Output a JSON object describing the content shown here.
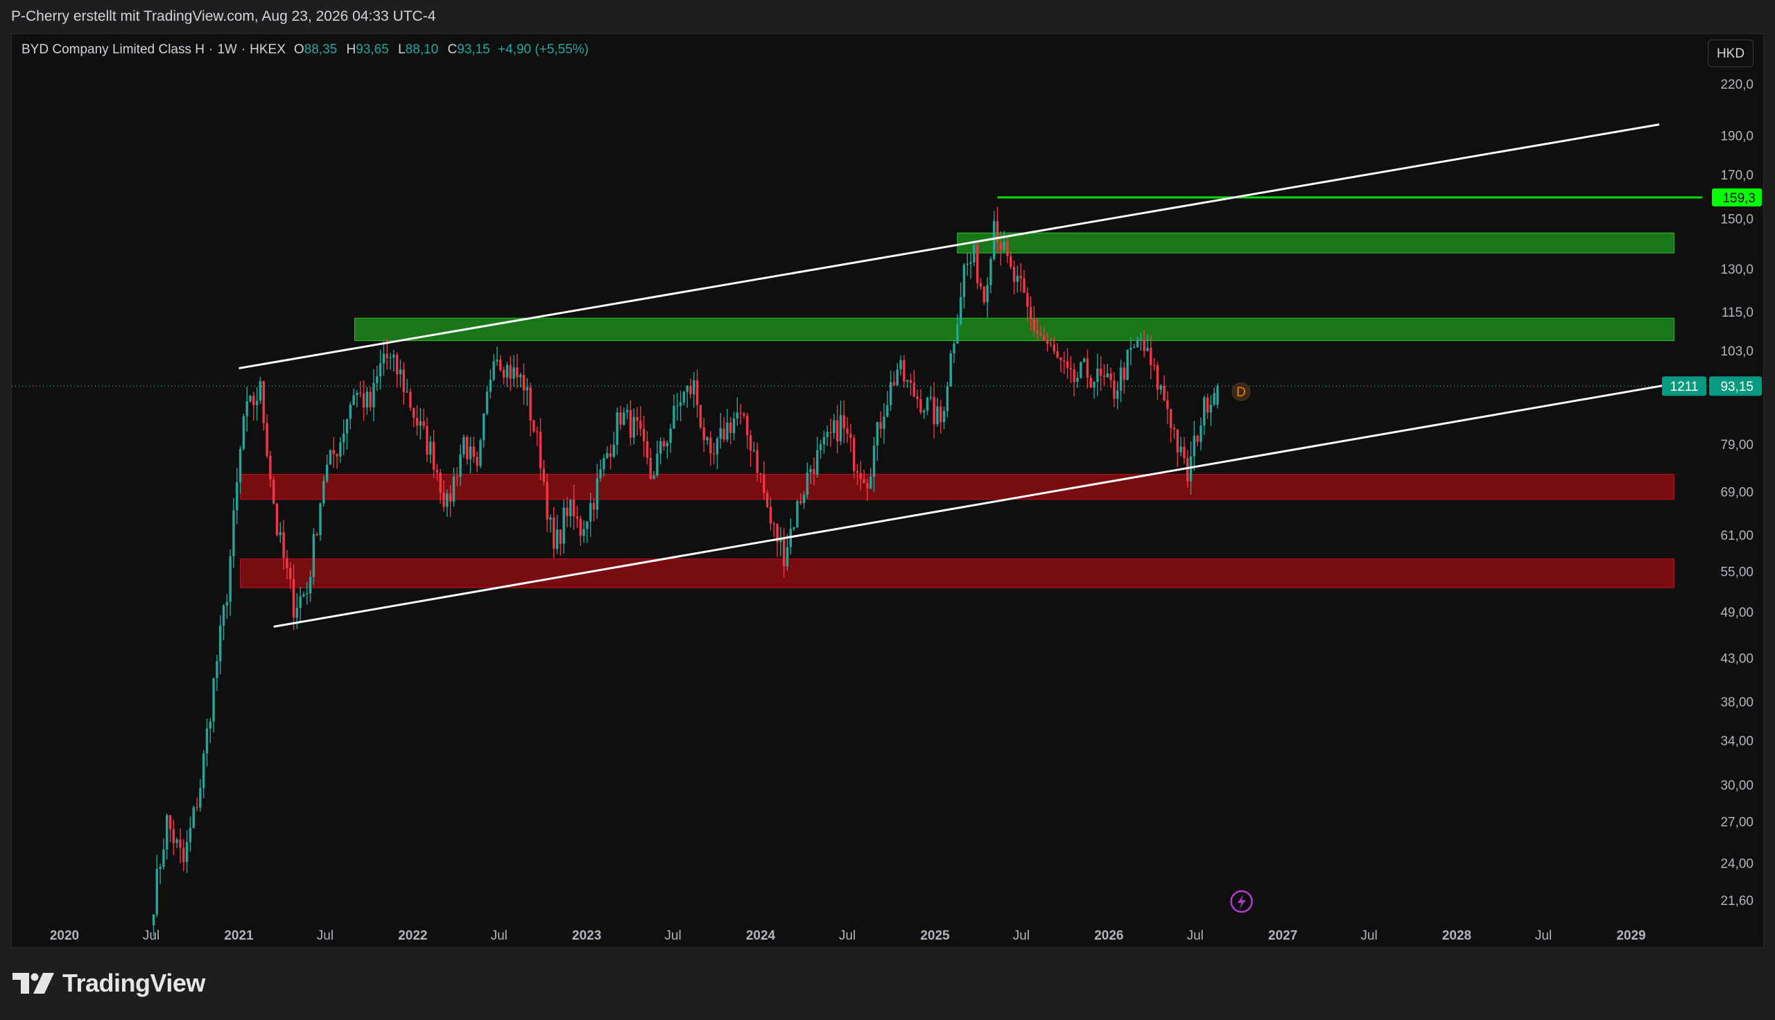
{
  "header": {
    "attribution": "P-Cherry erstellt mit TradingView.com, Aug 23, 2026 04:33 UTC-4"
  },
  "legend": {
    "symbol": "BYD Company Limited Class H",
    "interval": "1W",
    "exchange": "HKEX",
    "open_label": "O",
    "open": "88,35",
    "high_label": "H",
    "high": "93,65",
    "low_label": "L",
    "low": "88,10",
    "close_label": "C",
    "close": "93,15",
    "change": "+4,90 (+5,55%)"
  },
  "currency_button": "HKD",
  "footer": {
    "logo_text": "TradingView"
  },
  "colors": {
    "up": "#26a69a",
    "down": "#f23645",
    "background": "#0f0f0f",
    "green_zone": "#1b8a1b",
    "red_zone": "#8b0d12",
    "trendline": "#ffffff",
    "level_line": "#00e000",
    "price_label_bg": "#089981",
    "level_label_bg": "#00ff00"
  },
  "chart_data": {
    "type": "candlestick",
    "scale": "log",
    "currency": "HKD",
    "y_ticks": [
      "220,0",
      "190,0",
      "170,0",
      "150,0",
      "130,0",
      "115,0",
      "103,0",
      "79,00",
      "69,00",
      "61,00",
      "55,00",
      "49,00",
      "43,00",
      "38,00",
      "34,00",
      "30,00",
      "27,00",
      "24,00",
      "21,60"
    ],
    "x_ticks": [
      {
        "label": "2020",
        "date": "2020-01-01",
        "bold": true
      },
      {
        "label": "Jul",
        "date": "2020-07-01",
        "bold": false
      },
      {
        "label": "2021",
        "date": "2021-01-01",
        "bold": true
      },
      {
        "label": "Jul",
        "date": "2021-07-01",
        "bold": false
      },
      {
        "label": "2022",
        "date": "2022-01-01",
        "bold": true
      },
      {
        "label": "Jul",
        "date": "2022-07-01",
        "bold": false
      },
      {
        "label": "2023",
        "date": "2023-01-01",
        "bold": true
      },
      {
        "label": "Jul",
        "date": "2023-07-01",
        "bold": false
      },
      {
        "label": "2024",
        "date": "2024-01-01",
        "bold": true
      },
      {
        "label": "Jul",
        "date": "2024-07-01",
        "bold": false
      },
      {
        "label": "2025",
        "date": "2025-01-01",
        "bold": true
      },
      {
        "label": "Jul",
        "date": "2025-07-01",
        "bold": false
      },
      {
        "label": "2026",
        "date": "2026-01-01",
        "bold": true
      },
      {
        "label": "Jul",
        "date": "2026-07-01",
        "bold": false
      },
      {
        "label": "2027",
        "date": "2027-01-01",
        "bold": true
      },
      {
        "label": "Jul",
        "date": "2027-07-01",
        "bold": false
      },
      {
        "label": "2028",
        "date": "2028-01-01",
        "bold": true
      },
      {
        "label": "Jul",
        "date": "2028-07-01",
        "bold": false
      },
      {
        "label": "2029",
        "date": "2029-01-01",
        "bold": true
      }
    ],
    "price_key_points": [
      [
        "2020-07-06",
        21.6
      ],
      [
        "2020-08-03",
        27
      ],
      [
        "2020-09-07",
        24
      ],
      [
        "2020-10-12",
        30
      ],
      [
        "2020-11-09",
        40
      ],
      [
        "2020-12-07",
        52
      ],
      [
        "2021-01-11",
        85
      ],
      [
        "2021-02-15",
        92
      ],
      [
        "2021-03-22",
        62
      ],
      [
        "2021-04-26",
        50
      ],
      [
        "2021-05-24",
        52
      ],
      [
        "2021-06-28",
        72
      ],
      [
        "2021-08-02",
        80
      ],
      [
        "2021-08-30",
        92
      ],
      [
        "2021-10-04",
        88
      ],
      [
        "2021-11-01",
        102
      ],
      [
        "2021-12-06",
        96
      ],
      [
        "2022-01-10",
        84
      ],
      [
        "2022-02-14",
        76
      ],
      [
        "2022-03-14",
        66
      ],
      [
        "2022-04-18",
        80
      ],
      [
        "2022-05-16",
        72
      ],
      [
        "2022-06-20",
        104
      ],
      [
        "2022-07-18",
        98
      ],
      [
        "2022-08-22",
        94
      ],
      [
        "2022-09-26",
        76
      ],
      [
        "2022-10-24",
        58
      ],
      [
        "2022-11-21",
        66
      ],
      [
        "2022-12-19",
        62
      ],
      [
        "2023-01-16",
        68
      ],
      [
        "2023-02-13",
        77
      ],
      [
        "2023-03-13",
        86
      ],
      [
        "2023-04-17",
        82
      ],
      [
        "2023-05-15",
        72
      ],
      [
        "2023-06-19",
        81
      ],
      [
        "2023-07-17",
        90
      ],
      [
        "2023-08-14",
        93
      ],
      [
        "2023-09-18",
        74
      ],
      [
        "2023-10-16",
        82
      ],
      [
        "2023-11-13",
        86
      ],
      [
        "2023-12-18",
        78
      ],
      [
        "2024-01-22",
        63
      ],
      [
        "2024-02-19",
        58
      ],
      [
        "2024-03-18",
        66
      ],
      [
        "2024-04-15",
        74
      ],
      [
        "2024-05-13",
        78
      ],
      [
        "2024-06-17",
        84
      ],
      [
        "2024-07-15",
        76
      ],
      [
        "2024-08-12",
        72
      ],
      [
        "2024-09-16",
        88
      ],
      [
        "2024-10-14",
        98
      ],
      [
        "2024-11-11",
        92
      ],
      [
        "2024-12-16",
        88
      ],
      [
        "2025-01-13",
        84
      ],
      [
        "2025-02-10",
        108
      ],
      [
        "2025-03-03",
        130
      ],
      [
        "2025-03-24",
        134
      ],
      [
        "2025-04-14",
        120
      ],
      [
        "2025-05-05",
        150
      ],
      [
        "2025-05-19",
        140
      ],
      [
        "2025-06-09",
        128
      ],
      [
        "2025-06-30",
        122
      ],
      [
        "2025-07-21",
        112
      ],
      [
        "2025-08-18",
        106
      ],
      [
        "2025-09-15",
        100
      ],
      [
        "2025-10-13",
        94
      ],
      [
        "2025-11-10",
        97
      ],
      [
        "2025-12-08",
        95
      ],
      [
        "2026-01-12",
        92
      ],
      [
        "2026-02-09",
        100
      ],
      [
        "2026-03-09",
        106
      ],
      [
        "2026-04-06",
        96
      ],
      [
        "2026-05-04",
        88
      ],
      [
        "2026-06-01",
        76
      ],
      [
        "2026-06-15",
        72
      ],
      [
        "2026-07-06",
        82
      ],
      [
        "2026-07-27",
        90
      ],
      [
        "2026-08-17",
        93.15
      ]
    ],
    "zones": [
      {
        "name": "green-zone-upper",
        "color": "green",
        "from": "2025-02-17",
        "to": "2029-04-01",
        "low": 136,
        "high": 144
      },
      {
        "name": "green-zone-lower",
        "color": "green",
        "from": "2021-09-01",
        "to": "2029-04-01",
        "low": 106,
        "high": 113
      },
      {
        "name": "red-zone-upper",
        "color": "red",
        "from": "2021-01-04",
        "to": "2029-04-01",
        "low": 67.5,
        "high": 72.5
      },
      {
        "name": "red-zone-lower",
        "color": "red",
        "from": "2021-01-04",
        "to": "2029-04-01",
        "low": 52.5,
        "high": 57
      }
    ],
    "trendlines": [
      {
        "name": "upper-channel-line",
        "from": [
          "2021-01-01",
          98
        ],
        "to": [
          "2029-03-01",
          196
        ]
      },
      {
        "name": "lower-channel-line",
        "from": [
          "2021-03-15",
          47
        ],
        "to": [
          "2029-04-01",
          93.8
        ]
      }
    ],
    "horizontal_level": {
      "value": 159.3,
      "label": "159,3",
      "from": "2025-05-12"
    },
    "last_price": {
      "value": 93.15,
      "label": "93,15",
      "bar_countdown": "1211"
    },
    "dividend_marker": "D"
  }
}
